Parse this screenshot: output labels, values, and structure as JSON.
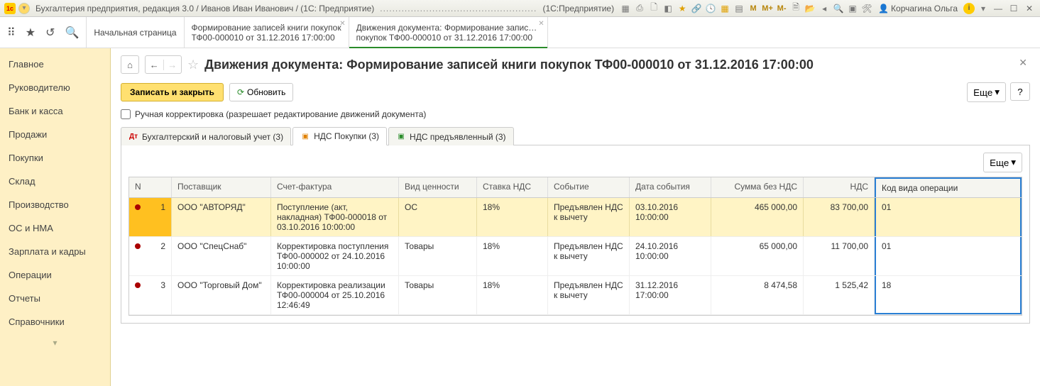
{
  "title_bar": {
    "app_title": "Бухгалтерия предприятия, редакция 3.0 / Иванов Иван Иванович / (1С: Предприятие)",
    "suffix": "(1С:Предприятие)",
    "user": "Корчагина Ольга",
    "m_buttons": [
      "M",
      "M+",
      "M-"
    ]
  },
  "top_tabs": [
    {
      "line1": "Начальная страница",
      "line2": ""
    },
    {
      "line1": "Формирование записей книги покупок",
      "line2": "ТФ00-000010 от 31.12.2016 17:00:00"
    },
    {
      "line1": "Движения документа: Формирование записей книги",
      "line2": "покупок ТФ00-000010 от 31.12.2016 17:00:00"
    }
  ],
  "sidebar": {
    "items": [
      "Главное",
      "Руководителю",
      "Банк и касса",
      "Продажи",
      "Покупки",
      "Склад",
      "Производство",
      "ОС и НМА",
      "Зарплата и кадры",
      "Операции",
      "Отчеты",
      "Справочники"
    ]
  },
  "page": {
    "title": "Движения документа: Формирование записей книги покупок ТФ00-000010 от 31.12.2016 17:00:00",
    "save_close": "Записать и закрыть",
    "refresh": "Обновить",
    "more": "Еще",
    "help": "?",
    "checkbox_label": "Ручная корректировка (разрешает редактирование движений документа)"
  },
  "inner_tabs": [
    {
      "label": "Бухгалтерский и налоговый учет (3)"
    },
    {
      "label": "НДС Покупки (3)"
    },
    {
      "label": "НДС предъявленный (3)"
    }
  ],
  "grid": {
    "more": "Еще",
    "headers": {
      "n": "N",
      "supplier": "Поставщик",
      "invoice": "Счет-фактура",
      "type": "Вид ценности",
      "rate": "Ставка НДС",
      "event": "Событие",
      "date": "Дата события",
      "sum": "Сумма без НДС",
      "vat": "НДС",
      "code": "Код вида операции"
    },
    "rows": [
      {
        "n": "1",
        "supplier": "ООО \"АВТОРЯД\"",
        "invoice": "Поступление (акт, накладная) ТФ00-000018 от 03.10.2016 10:00:00",
        "type": "ОС",
        "rate": "18%",
        "event": "Предъявлен НДС к вычету",
        "date": "03.10.2016 10:00:00",
        "sum": "465 000,00",
        "vat": "83 700,00",
        "code": "01"
      },
      {
        "n": "2",
        "supplier": "ООО \"СпецСнаб\"",
        "invoice": "Корректировка поступления ТФ00-000002 от 24.10.2016 10:00:00",
        "type": "Товары",
        "rate": "18%",
        "event": "Предъявлен НДС к вычету",
        "date": "24.10.2016 10:00:00",
        "sum": "65 000,00",
        "vat": "11 700,00",
        "code": "01"
      },
      {
        "n": "3",
        "supplier": "ООО \"Торговый Дом\"",
        "invoice": "Корректировка реализации ТФ00-000004 от 25.10.2016 12:46:49",
        "type": "Товары",
        "rate": "18%",
        "event": "Предъявлен НДС к вычету",
        "date": "31.12.2016 17:00:00",
        "sum": "8 474,58",
        "vat": "1 525,42",
        "code": "18"
      }
    ]
  }
}
